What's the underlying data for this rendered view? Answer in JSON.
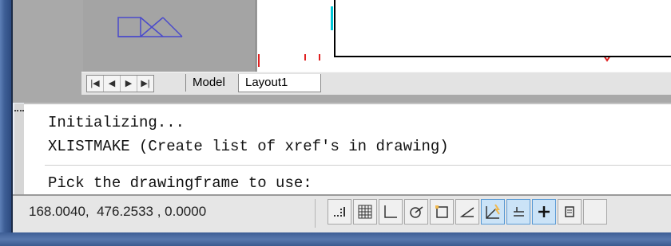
{
  "layout_tabs": {
    "nav_icons": [
      "first-layout-icon",
      "previous-layout-icon",
      "next-layout-icon",
      "last-layout-icon"
    ],
    "nav_glyphs": [
      "|◀",
      "◀",
      "▶",
      "▶|"
    ],
    "model_label": "Model",
    "layout_label": "Layout1"
  },
  "command_window": {
    "lines": [
      "Initializing...",
      "XLISTMAKE (Create list of xref's in drawing)"
    ],
    "prompt": "Pick the drawingframe to use:"
  },
  "status_bar": {
    "coordinates": "168.0040,  476.2533 , 0.0000",
    "toggles": [
      {
        "name": "infer-constraints-icon",
        "on": false
      },
      {
        "name": "snap-mode-icon",
        "on": false
      },
      {
        "name": "grid-display-icon",
        "on": false
      },
      {
        "name": "ortho-mode-icon",
        "on": false
      },
      {
        "name": "polar-tracking-icon",
        "on": false
      },
      {
        "name": "object-snap-icon",
        "on": false
      },
      {
        "name": "3d-object-snap-icon",
        "on": true
      },
      {
        "name": "object-snap-tracking-icon",
        "on": true
      },
      {
        "name": "dynamic-ucs-icon",
        "on": true
      },
      {
        "name": "dynamic-input-icon",
        "on": false
      },
      {
        "name": "show-lineweight-icon",
        "on": false
      }
    ]
  },
  "colors": {
    "frame_blue": "#3e5f96",
    "workspace_gray": "#a9a9a9",
    "drawing_blue": "#4a4acb",
    "marker_red": "#e02020",
    "marker_cyan": "#00c8d8",
    "toggle_on_blue": "#cbe3f7"
  }
}
